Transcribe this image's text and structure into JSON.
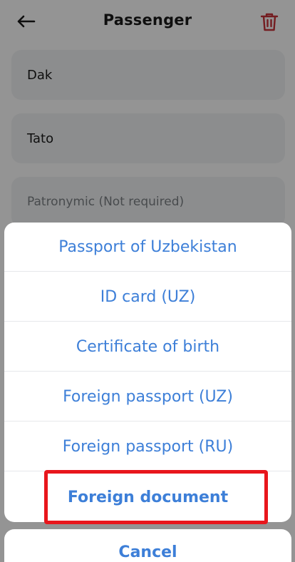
{
  "header": {
    "title": "Passenger",
    "back_icon": "arrow-left-icon",
    "delete_icon": "trash-icon",
    "delete_color": "#c9333a"
  },
  "fields": [
    {
      "value": "Dak"
    },
    {
      "value": "Tato"
    },
    {
      "placeholder": "Patronymic (Not required)"
    }
  ],
  "sheet": {
    "options": [
      "Passport of Uzbekistan",
      "ID card (UZ)",
      "Certificate of birth",
      "Foreign passport (UZ)",
      "Foreign passport (RU)",
      "Foreign document"
    ],
    "cancel_label": "Cancel",
    "accent_color": "#3d7fd8",
    "highlight_color": "#e8161c"
  }
}
